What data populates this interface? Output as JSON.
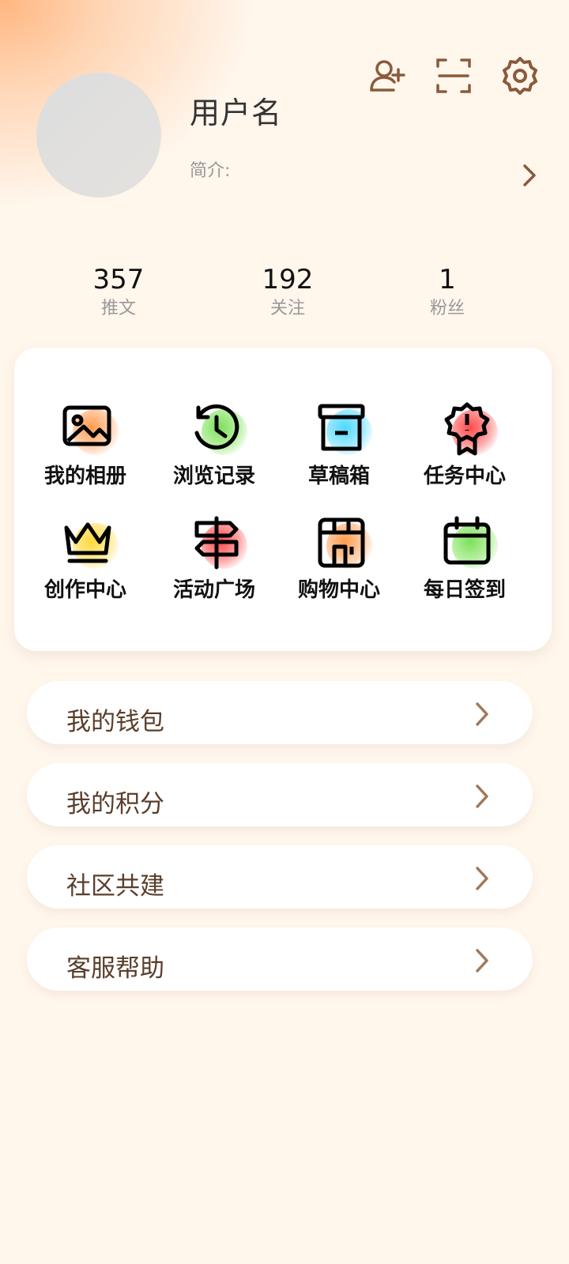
{
  "profile": {
    "username": "用户名",
    "bio_label": "简介:"
  },
  "header_icons": [
    "add-friend-icon",
    "scan-icon",
    "settings-icon"
  ],
  "stats": [
    {
      "value": "357",
      "label": "推文"
    },
    {
      "value": "192",
      "label": "关注"
    },
    {
      "value": "1",
      "label": "粉丝"
    }
  ],
  "grid": [
    {
      "label": "我的相册",
      "icon": "photo-album-icon",
      "accent": "#ffb27a"
    },
    {
      "label": "浏览记录",
      "icon": "history-icon",
      "accent": "#8ee86a"
    },
    {
      "label": "草稿箱",
      "icon": "archive-icon",
      "accent": "#6adfff"
    },
    {
      "label": "任务中心",
      "icon": "badge-icon",
      "accent": "#ff6b6b"
    },
    {
      "label": "创作中心",
      "icon": "crown-icon",
      "accent": "#ffe066"
    },
    {
      "label": "活动广场",
      "icon": "signpost-icon",
      "accent": "#ff6b6b"
    },
    {
      "label": "购物中心",
      "icon": "shop-icon",
      "accent": "#ffb27a"
    },
    {
      "label": "每日签到",
      "icon": "calendar-icon",
      "accent": "#8ee86a"
    }
  ],
  "menu": [
    {
      "label": "我的钱包"
    },
    {
      "label": "我的积分"
    },
    {
      "label": "社区共建"
    },
    {
      "label": "客服帮助"
    }
  ],
  "colors": {
    "background": "#fff6ec",
    "accent_brown": "#8b5a3c",
    "menu_text": "#5a3e2b"
  }
}
